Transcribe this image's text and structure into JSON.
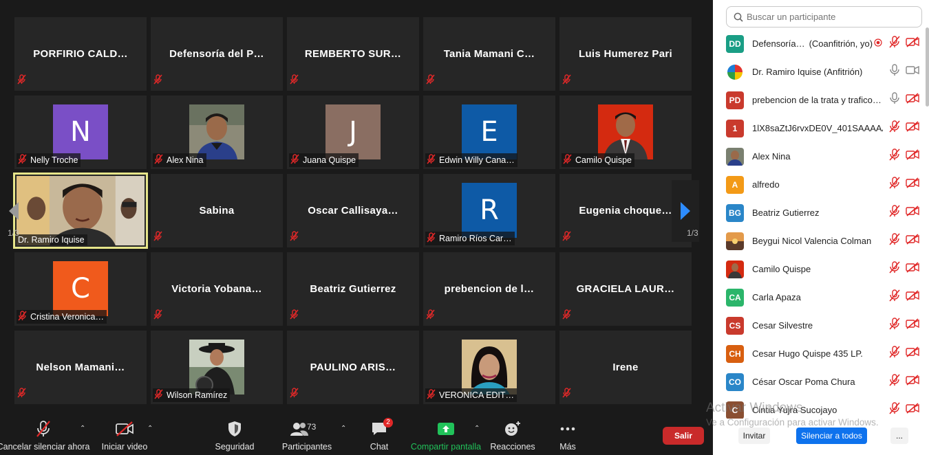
{
  "gallery": {
    "page_left": "1/3",
    "page_right": "1/3",
    "tiles": [
      {
        "kind": "name",
        "name": "PORFIRIO  CALD…"
      },
      {
        "kind": "name",
        "name": "Defensoría  del  P…"
      },
      {
        "kind": "name",
        "name": "REMBERTO  SUR…"
      },
      {
        "kind": "name",
        "name": "Tania  Mamani  C…"
      },
      {
        "kind": "name",
        "name": "Luis Humerez Pari"
      },
      {
        "kind": "avatar",
        "letter": "N",
        "color": "#7a4fc6",
        "label": "Nelly Troche"
      },
      {
        "kind": "photo",
        "photo": "alex",
        "label": "Alex Nina"
      },
      {
        "kind": "avatar",
        "letter": "J",
        "color": "#8a6e62",
        "label": "Juana Quispe"
      },
      {
        "kind": "avatar",
        "letter": "E",
        "color": "#0e5aa6",
        "label": "Edwin Willy Cana…"
      },
      {
        "kind": "photo",
        "photo": "camilo",
        "label": "Camilo Quispe"
      },
      {
        "kind": "video",
        "label": "Dr. Ramiro Iquise",
        "active": true
      },
      {
        "kind": "name",
        "name": "Sabina"
      },
      {
        "kind": "name",
        "name": "Oscar  Callisaya…"
      },
      {
        "kind": "avatar",
        "letter": "R",
        "color": "#0e5aa6",
        "label": "Ramiro Ríos Car…"
      },
      {
        "kind": "name",
        "name": "Eugenia  choque…"
      },
      {
        "kind": "avatar",
        "letter": "C",
        "color": "#f05a1c",
        "label": "Cristina Veronica…"
      },
      {
        "kind": "name",
        "name": "Victoria  Yobana…"
      },
      {
        "kind": "name",
        "name": "Beatriz Gutierrez"
      },
      {
        "kind": "name",
        "name": "prebencion  de  l…"
      },
      {
        "kind": "name",
        "name": "GRACIELA  LAUR…"
      },
      {
        "kind": "name",
        "name": "Nelson  Mamani…"
      },
      {
        "kind": "photo",
        "photo": "wilson",
        "label": "Wilson Ramírez"
      },
      {
        "kind": "name",
        "name": "PAULINO  ARIS…"
      },
      {
        "kind": "photo",
        "photo": "veronica",
        "label": "VERONICA EDIT…"
      },
      {
        "kind": "name",
        "name": "Irene"
      }
    ]
  },
  "toolbar": {
    "unmute_label": "Cancelar silenciar ahora",
    "video_label": "Iniciar video",
    "security_label": "Seguridad",
    "participants_label": "Participantes",
    "participants_count": "73",
    "chat_label": "Chat",
    "chat_badge": "2",
    "share_label": "Compartir pantalla",
    "reactions_label": "Reacciones",
    "more_label": "Más",
    "leave_label": "Salir",
    "share_color": "#21c25a"
  },
  "panel": {
    "search_placeholder": "Buscar un participante",
    "participants": [
      {
        "initials": "DD",
        "color": "#1a9e85",
        "name": "Defensoría…",
        "role": "(Coanfitrión, yo)",
        "rec": true,
        "mic": "muted",
        "cam": "off"
      },
      {
        "initials": "",
        "avatar": "logo",
        "name": "Dr. Ramiro Iquise (Anfitrión)",
        "mic": "on",
        "cam": "on"
      },
      {
        "initials": "PD",
        "color": "#c93a2d",
        "name": "prebencion de la trata y trafico…",
        "mic": "on",
        "cam": "off"
      },
      {
        "initials": "1",
        "color": "#c93a2d",
        "name": "1lX8saZtJ6rvxDE0V_401SAAAAA…",
        "mic": "muted",
        "cam": "off"
      },
      {
        "initials": "",
        "avatar": "alex",
        "name": "Alex Nina",
        "mic": "muted",
        "cam": "off"
      },
      {
        "initials": "A",
        "color": "#f39a17",
        "name": "alfredo",
        "mic": "muted",
        "cam": "off"
      },
      {
        "initials": "BG",
        "color": "#2a86c8",
        "name": "Beatriz Gutierrez",
        "mic": "muted",
        "cam": "off"
      },
      {
        "initials": "",
        "avatar": "sunset",
        "name": "Beygui Nicol Valencia Colman",
        "mic": "muted",
        "cam": "off"
      },
      {
        "initials": "",
        "avatar": "camilo",
        "name": "Camilo Quispe",
        "mic": "muted",
        "cam": "off"
      },
      {
        "initials": "CA",
        "color": "#2bb56a",
        "name": "Carla  Apaza",
        "mic": "muted",
        "cam": "off"
      },
      {
        "initials": "CS",
        "color": "#c93a2d",
        "name": "Cesar  Silvestre",
        "mic": "muted",
        "cam": "off"
      },
      {
        "initials": "CH",
        "color": "#d85f10",
        "name": "Cesar Hugo Quispe 435 LP.",
        "mic": "muted",
        "cam": "off"
      },
      {
        "initials": "CO",
        "color": "#2a86c8",
        "name": "César Oscar Poma Chura",
        "mic": "muted",
        "cam": "off"
      },
      {
        "initials": "C",
        "color": "#8a4f32",
        "name": "Cintia Yujra Sucojayo",
        "mic": "muted",
        "cam": "off"
      }
    ],
    "invite_label": "Invitar",
    "mute_all_label": "Silenciar a todos",
    "more_label": "...",
    "accent": "#0e72ed"
  },
  "watermark": {
    "line1": "Activar Windows",
    "line2": "Ve a Configuración para activar Windows."
  }
}
